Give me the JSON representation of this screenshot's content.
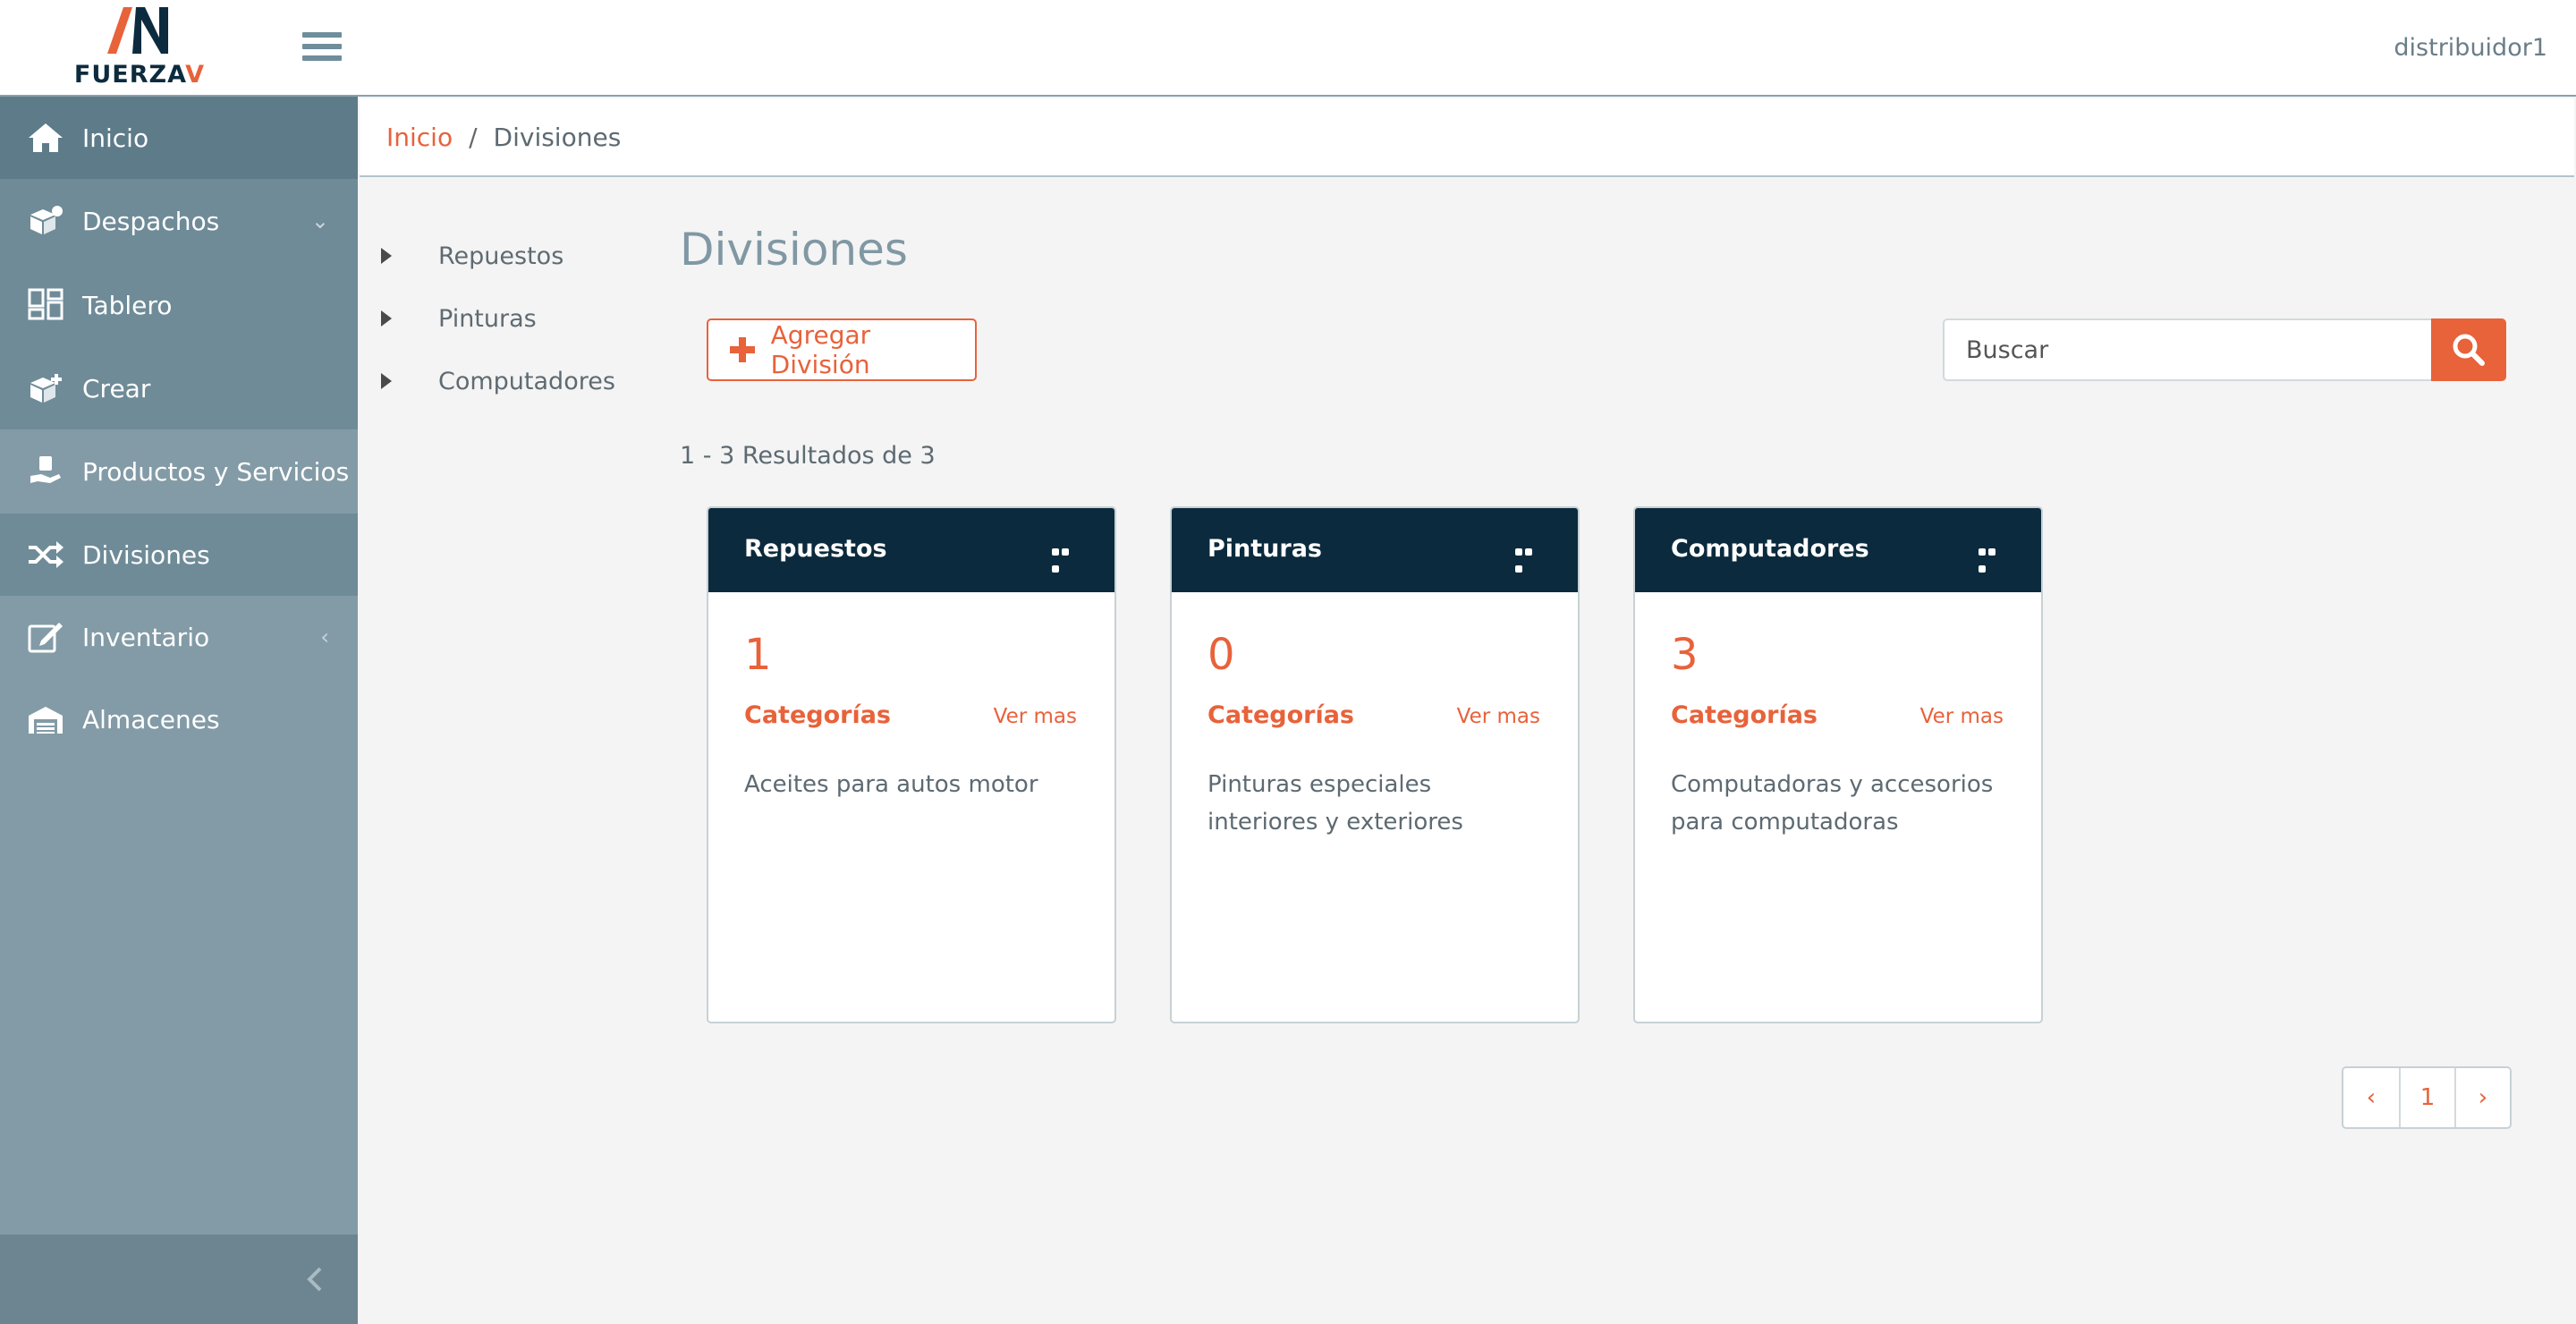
{
  "header": {
    "logo_text": "FUERZA",
    "logo_accent": "V",
    "user": "distribuidor1"
  },
  "sidebar": {
    "items": [
      {
        "label": "Inicio",
        "icon": "home-icon"
      },
      {
        "label": "Despachos",
        "icon": "boxes-icon",
        "caret": "⌄"
      },
      {
        "label": "Tablero",
        "icon": "dashboard-icon"
      },
      {
        "label": "Crear",
        "icon": "box-plus-icon"
      },
      {
        "label": "Productos y Servicios",
        "icon": "hand-box-icon"
      },
      {
        "label": "Divisiones",
        "icon": "shuffle-icon"
      },
      {
        "label": "Inventario",
        "icon": "edit-square-icon",
        "caret": "‹"
      },
      {
        "label": "Almacenes",
        "icon": "warehouse-icon"
      }
    ]
  },
  "breadcrumb": {
    "home": "Inicio",
    "separator": "/",
    "current": "Divisiones"
  },
  "tree": [
    "Repuestos",
    "Pinturas",
    "Computadores"
  ],
  "main": {
    "title": "Divisiones",
    "add_button": "Agregar División",
    "search_placeholder": "Buscar",
    "results": "1 - 3 Resultados de 3"
  },
  "cards": [
    {
      "title": "Repuestos",
      "count": "1",
      "categories_label": "Categorías",
      "more": "Ver mas",
      "description": "Aceites para autos motor"
    },
    {
      "title": "Pinturas",
      "count": "0",
      "categories_label": "Categorías",
      "more": "Ver mas",
      "description": "Pinturas especiales interiores y exteriores"
    },
    {
      "title": "Computadores",
      "count": "3",
      "categories_label": "Categorías",
      "more": "Ver mas",
      "description": "Computadoras y accesorios para computadoras"
    }
  ],
  "pagination": {
    "prev": "‹",
    "page": "1",
    "next": "›"
  },
  "colors": {
    "accent": "#e8623a",
    "sidebar": "#839ba6",
    "card_header": "#0b2a3d"
  }
}
